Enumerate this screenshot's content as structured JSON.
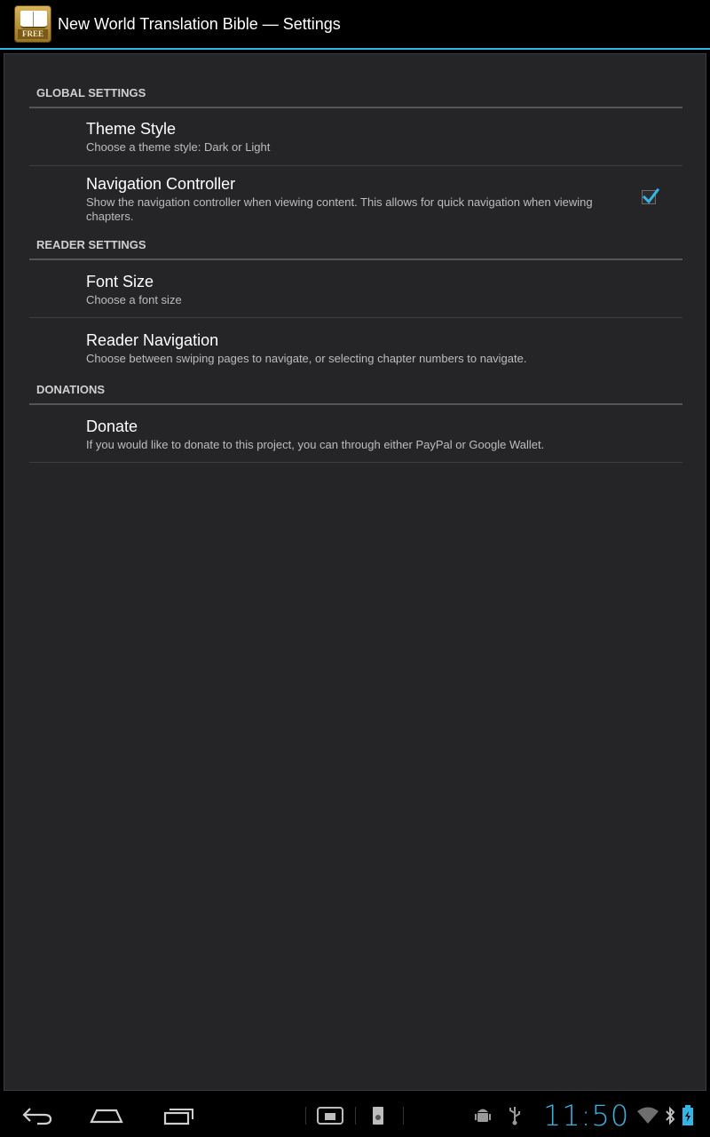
{
  "app": {
    "title": "New World Translation Bible — Settings",
    "icon_badge": "FREE",
    "icon": "bible-app-icon"
  },
  "sections": [
    {
      "header": "GLOBAL SETTINGS",
      "prefs": [
        {
          "title": "Theme Style",
          "summary": "Choose a theme style: Dark or Light"
        },
        {
          "title": "Navigation Controller",
          "summary": "Show the navigation controller when viewing content. This allows for quick navigation when viewing chapters.",
          "checked": true
        }
      ]
    },
    {
      "header": "READER SETTINGS",
      "prefs": [
        {
          "title": "Font Size",
          "summary": "Choose a font size"
        },
        {
          "title": "Reader Navigation",
          "summary": "Choose between swiping pages to navigate, or selecting chapter numbers to navigate."
        }
      ]
    },
    {
      "header": "DONATIONS",
      "prefs": [
        {
          "title": "Donate",
          "summary": "If you would like to donate to this project, you can through either PayPal or Google Wallet."
        }
      ]
    }
  ],
  "status": {
    "time": "11:50",
    "icons": [
      "android-debug-icon",
      "usb-icon",
      "wifi-icon",
      "bluetooth-icon",
      "battery-icon"
    ]
  },
  "nav": {
    "buttons": [
      "back-icon",
      "home-icon",
      "recent-apps-icon"
    ],
    "extra": [
      "screen-compat-icon",
      "sd-card-icon"
    ]
  },
  "colors": {
    "accent": "#33b5e5",
    "background": "#252528",
    "checkbox_check": "#33b5e5"
  }
}
